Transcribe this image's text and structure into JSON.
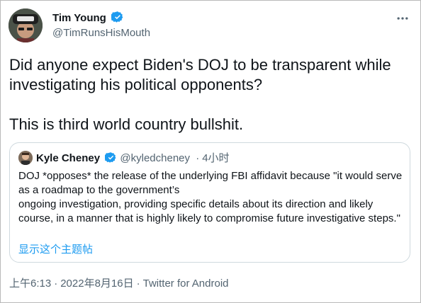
{
  "tweet": {
    "author": {
      "name": "Tim Young",
      "handle": "@TimRunsHisMouth",
      "verified": true
    },
    "text": "Did anyone expect Biden's DOJ to be transparent while investigating his political opponents?\n\nThis is third world country bullshit.",
    "quoted": {
      "author_name": "Kyle Cheney",
      "verified": true,
      "handle": "@kyledcheney",
      "separator": "·",
      "time_ago": "4小时",
      "text": "DOJ *opposes* the release of the underlying FBI affidavit because \"it would serve as a roadmap to the government’s\nongoing investigation, providing specific details about its direction and likely course, in a manner that is highly likely to compromise future investigative steps.\"",
      "show_thread_label": "显示这个主题帖"
    },
    "meta": {
      "time": "上午6:13",
      "separator": "·",
      "date": "2022年8月16日",
      "source": "Twitter for Android"
    }
  },
  "colors": {
    "verified_badge": "#1d9bf0",
    "link": "#1d9bf0",
    "secondary_text": "#536471",
    "card_border": "#cfd9de"
  },
  "icons": {
    "verified": "verified-badge-icon",
    "more": "more-options-icon"
  }
}
